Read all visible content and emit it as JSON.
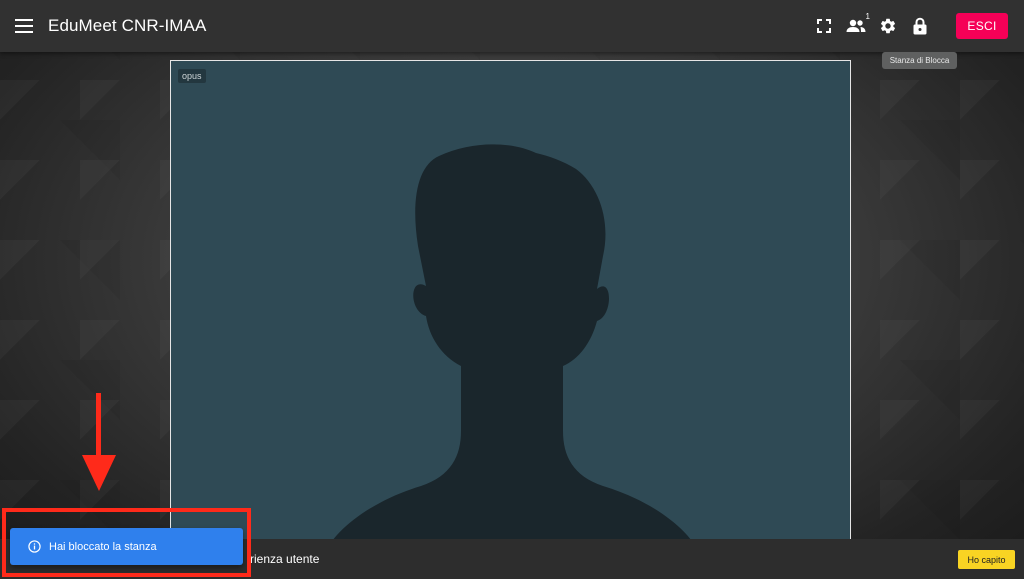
{
  "app": {
    "title": "EduMeet CNR-IMAA"
  },
  "toolbar": {
    "participants_count": "1",
    "exit_label": "ESCI",
    "lock_tooltip": "Stanza di Blocca",
    "icons": [
      "menu-icon",
      "fullscreen-icon",
      "participants-icon",
      "settings-icon",
      "lock-icon"
    ]
  },
  "video": {
    "label": "opus",
    "tile_color": "#2f4a55",
    "silhouette_color": "#1a262c"
  },
  "bottom_bar": {
    "text": "rienza utente",
    "ok_label": "Ho capito",
    "ok_color": "#f9d423"
  },
  "snackbar": {
    "message": "Hai bloccato la stanza",
    "color": "#2f80ed",
    "icon": "info-icon"
  },
  "annotation": {
    "color": "#ff2a1a"
  }
}
